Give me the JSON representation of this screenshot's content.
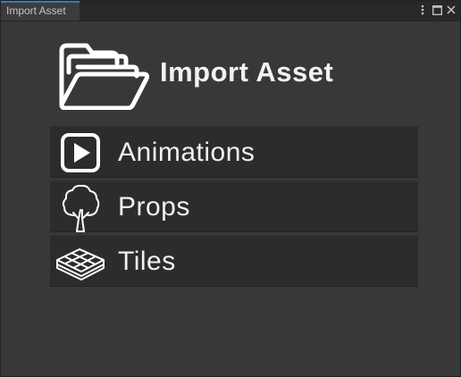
{
  "window": {
    "tab_title": "Import Asset",
    "controls": {
      "menu_icon": "kebab-menu-icon",
      "maximize_icon": "maximize-icon",
      "close_icon": "close-icon"
    }
  },
  "header": {
    "icon": "folder-open-icon",
    "title": "Import Asset"
  },
  "menu": {
    "items": [
      {
        "label": "Animations",
        "icon": "play-icon"
      },
      {
        "label": "Props",
        "icon": "tree-icon"
      },
      {
        "label": "Tiles",
        "icon": "tiles-icon"
      }
    ]
  },
  "colors": {
    "panel_bg": "#383838",
    "item_bg": "#2c2c2c",
    "tab_accent": "#3a79bb",
    "text": "#f0f0f0"
  }
}
